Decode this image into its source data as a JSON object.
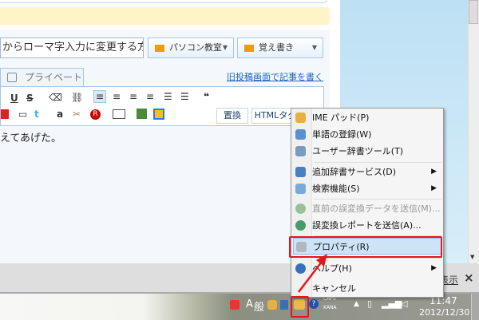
{
  "editor": {
    "title_value": "からローマ字入力に変更する方法",
    "category1": "パソコン教室",
    "category2": "覚え書き",
    "tab_private": "プライベート",
    "old_editor_link": "旧投稿画面で記事を書く",
    "replace_button": "置換",
    "html_tag_button": "HTMLタグ",
    "body_text": "えてあげた。"
  },
  "menu": {
    "items": [
      {
        "label": "IME パッド(P)",
        "icon": "ime-pad-icon"
      },
      {
        "label": "単語の登録(W)",
        "icon": "word-register-icon"
      },
      {
        "label": "ユーザー辞書ツール(T)",
        "icon": "user-dictionary-icon"
      },
      {
        "label": "追加辞書サービス(D)",
        "icon": "add-dictionary-icon"
      },
      {
        "label": "検索機能(S)",
        "icon": "search-icon"
      },
      {
        "label": "直前の誤変換データを送信(M)...",
        "icon": "send-data-icon"
      },
      {
        "label": "誤変換レポートを送信(A)...",
        "icon": "send-report-icon"
      },
      {
        "label": "プロパティ(R)",
        "icon": "properties-icon"
      },
      {
        "label": "ヘルプ(H)",
        "icon": "help-icon"
      },
      {
        "label": "キャンセル"
      }
    ]
  },
  "notification": {
    "show_label": "表示",
    "close": "×"
  },
  "taskbar": {
    "ime_mode": "A",
    "ime_kanji": "般",
    "caps": "CAPS",
    "kana": "KANA",
    "time": "11:47",
    "date": "2012/12/30"
  },
  "colors": {
    "highlight": "#e8141c",
    "accent": "#1a63c0"
  }
}
